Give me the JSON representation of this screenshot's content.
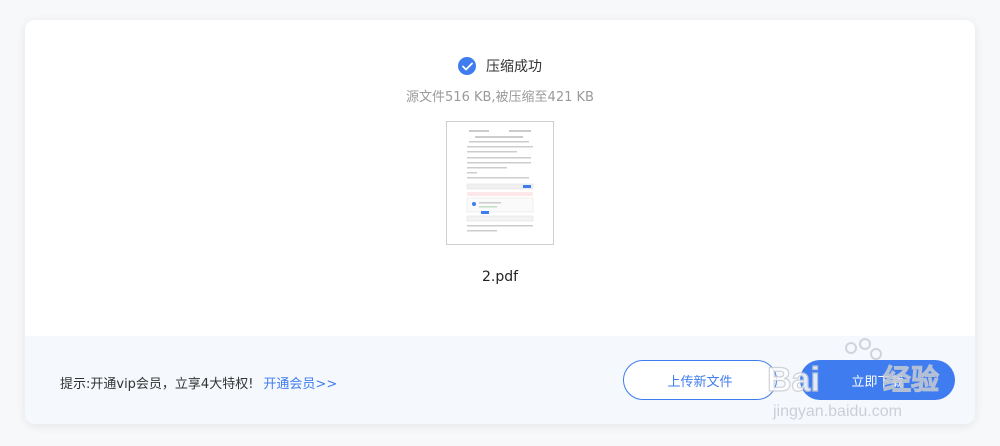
{
  "status": {
    "title": "压缩成功",
    "size_info": "源文件516 KB,被压缩至421 KB"
  },
  "file": {
    "name": "2.pdf"
  },
  "footer": {
    "tip_text": "提示:开通vip会员，立享4大特权!",
    "tip_link": "开通会员>>",
    "upload_label": "上传新文件",
    "download_label": "立即下载"
  },
  "watermark": {
    "brand": "Baidu经验",
    "url": "jingyan.baidu.com"
  },
  "colors": {
    "accent": "#3f7cf0"
  },
  "icons": {
    "check": "check-circle-icon"
  }
}
